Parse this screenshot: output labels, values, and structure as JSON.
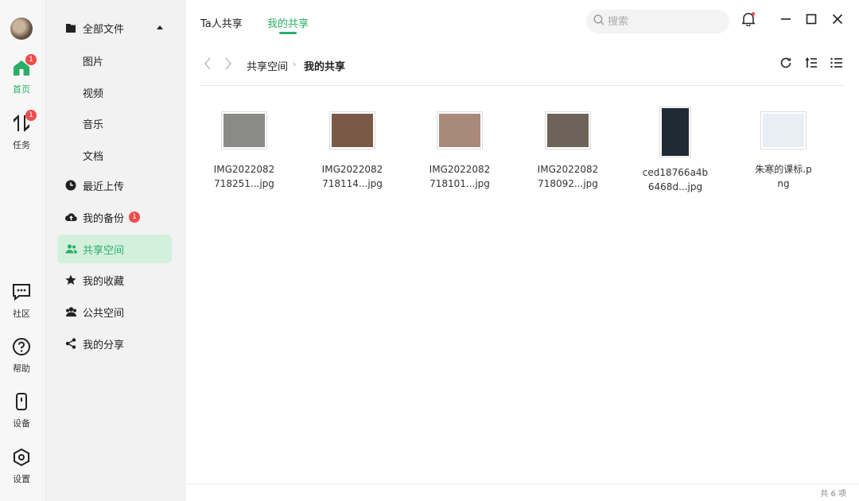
{
  "rail": {
    "items": [
      {
        "label": "首页",
        "badge": "1",
        "icon": "home-icon"
      },
      {
        "label": "任务",
        "badge": "1",
        "icon": "transfer-icon"
      },
      {
        "label": "社区",
        "icon": "chat-icon"
      },
      {
        "label": "帮助",
        "icon": "help-icon"
      },
      {
        "label": "设备",
        "icon": "device-icon"
      },
      {
        "label": "设置",
        "icon": "settings-icon"
      }
    ]
  },
  "sidebar": {
    "all_files": "全部文件",
    "sub": [
      "图片",
      "视频",
      "音乐",
      "文档"
    ],
    "recent": "最近上传",
    "backup": "我的备份",
    "backup_badge": "1",
    "shared_space": "共享空间",
    "favorites": "我的收藏",
    "public_space": "公共空间",
    "my_share": "我的分享"
  },
  "header": {
    "tabs": [
      "Ta人共享",
      "我的共享"
    ],
    "active_tab": "我的共享",
    "search_placeholder": "搜索"
  },
  "breadcrumb": {
    "root": "共享空间",
    "current": "我的共享"
  },
  "files": [
    {
      "name": "IMG2022082718251...jpg",
      "line1": "IMG2022082",
      "line2": "718251...jpg",
      "thumb": "#8a8a86"
    },
    {
      "name": "IMG2022082718114...jpg",
      "line1": "IMG2022082",
      "line2": "718114...jpg",
      "thumb": "#7a5a47"
    },
    {
      "name": "IMG2022082718101...jpg",
      "line1": "IMG2022082",
      "line2": "718101...jpg",
      "thumb": "#a8897a"
    },
    {
      "name": "IMG2022082718092...jpg",
      "line1": "IMG2022082",
      "line2": "718092...jpg",
      "thumb": "#6d6358"
    },
    {
      "name": "ced18766a4b6468d...jpg",
      "line1": "ced18766a4b",
      "line2": "6468d...jpg",
      "thumb": "#1f2a33"
    },
    {
      "name": "朱寒的课标.png",
      "line1": "朱寒的课标.p",
      "line2": "ng",
      "thumb": "#e9eef5"
    }
  ],
  "status": {
    "count_text": "共 6 项"
  },
  "colors": {
    "accent": "#2aae67",
    "badge": "#ee4b4b"
  }
}
